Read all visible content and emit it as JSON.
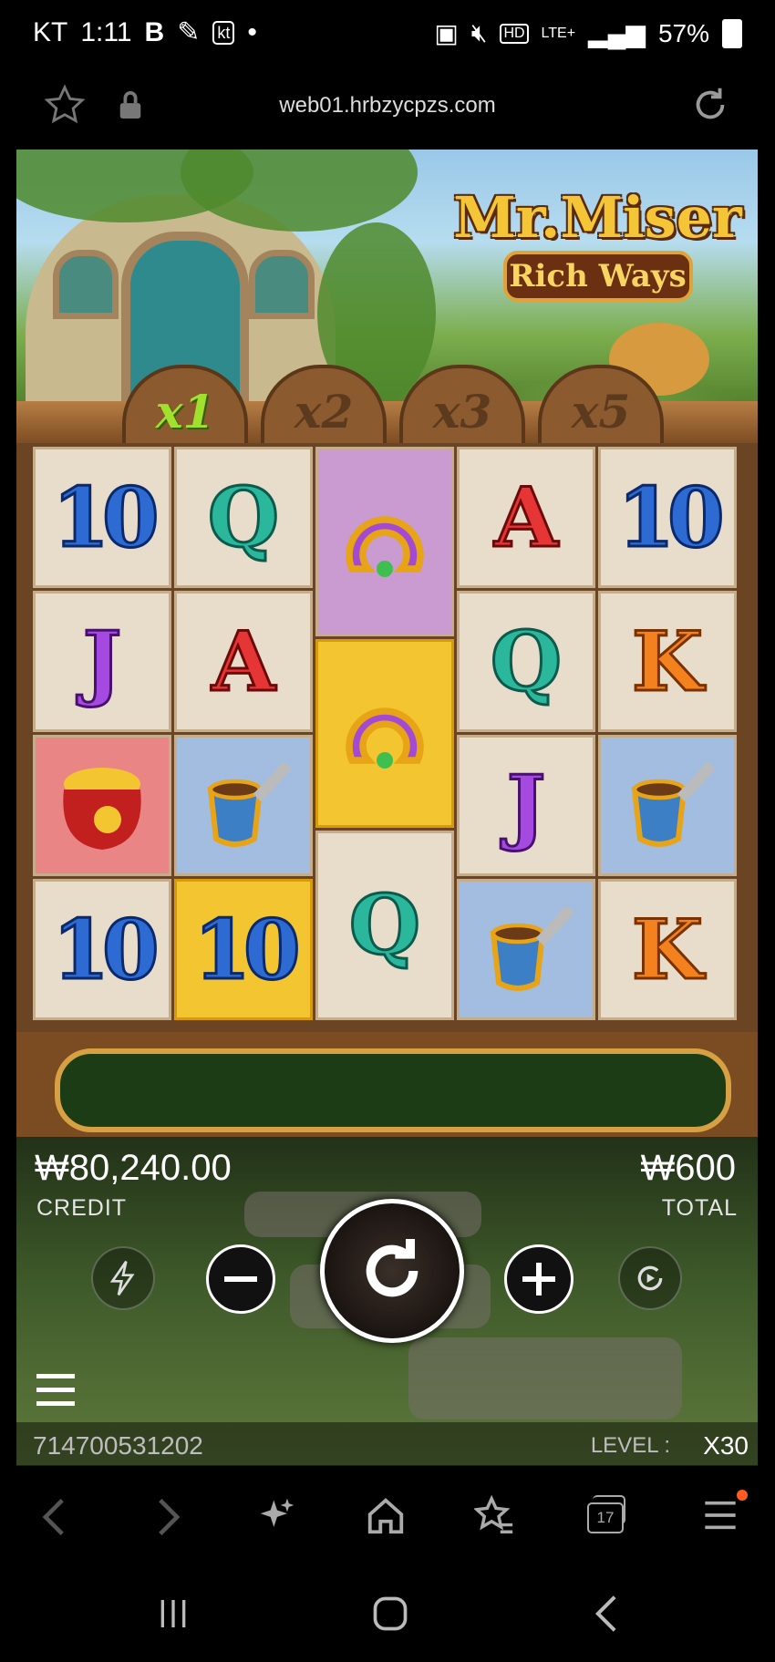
{
  "status_bar": {
    "carrier": "KT",
    "time": "1:11",
    "kt_badge": "kt",
    "dot": "•",
    "battery_percent": "57%",
    "hd": "HD",
    "lte": "LTE+"
  },
  "browser": {
    "url": "web01.hrbzycpzs.com"
  },
  "game": {
    "logo_line1": "Mr.Miser",
    "logo_line2": "Rich Ways",
    "multipliers": [
      {
        "label": "x1",
        "active": true
      },
      {
        "label": "x2",
        "active": false
      },
      {
        "label": "x3",
        "active": false
      },
      {
        "label": "x5",
        "active": false
      }
    ],
    "reels": [
      [
        {
          "symbol": "10",
          "bg": "plain"
        },
        {
          "symbol": "J",
          "bg": "plain"
        },
        {
          "symbol": "pot-of-gold",
          "bg": "red"
        },
        {
          "symbol": "10",
          "bg": "plain"
        }
      ],
      [
        {
          "symbol": "Q",
          "bg": "plain"
        },
        {
          "symbol": "A",
          "bg": "plain"
        },
        {
          "symbol": "pipe",
          "bg": "blue"
        },
        {
          "symbol": "10",
          "bg": "gold"
        }
      ],
      [
        {
          "symbol": "horseshoe",
          "bg": "purple"
        },
        {
          "symbol": "horseshoe",
          "bg": "gold"
        },
        {
          "symbol": "Q",
          "bg": "plain"
        }
      ],
      [
        {
          "symbol": "A",
          "bg": "plain"
        },
        {
          "symbol": "Q",
          "bg": "plain"
        },
        {
          "symbol": "J",
          "bg": "plain"
        },
        {
          "symbol": "pipe",
          "bg": "blue"
        }
      ],
      [
        {
          "symbol": "10",
          "bg": "plain"
        },
        {
          "symbol": "K",
          "bg": "plain"
        },
        {
          "symbol": "pipe",
          "bg": "blue"
        },
        {
          "symbol": "K",
          "bg": "plain"
        }
      ]
    ],
    "credit_value": "₩80,240.00",
    "credit_label": "CREDIT",
    "total_value": "₩600",
    "total_label": "TOTAL",
    "session_id": "714700531202",
    "level_label": "LEVEL :",
    "level_value": "X30"
  },
  "browser_nav": {
    "tab_count": "17"
  }
}
